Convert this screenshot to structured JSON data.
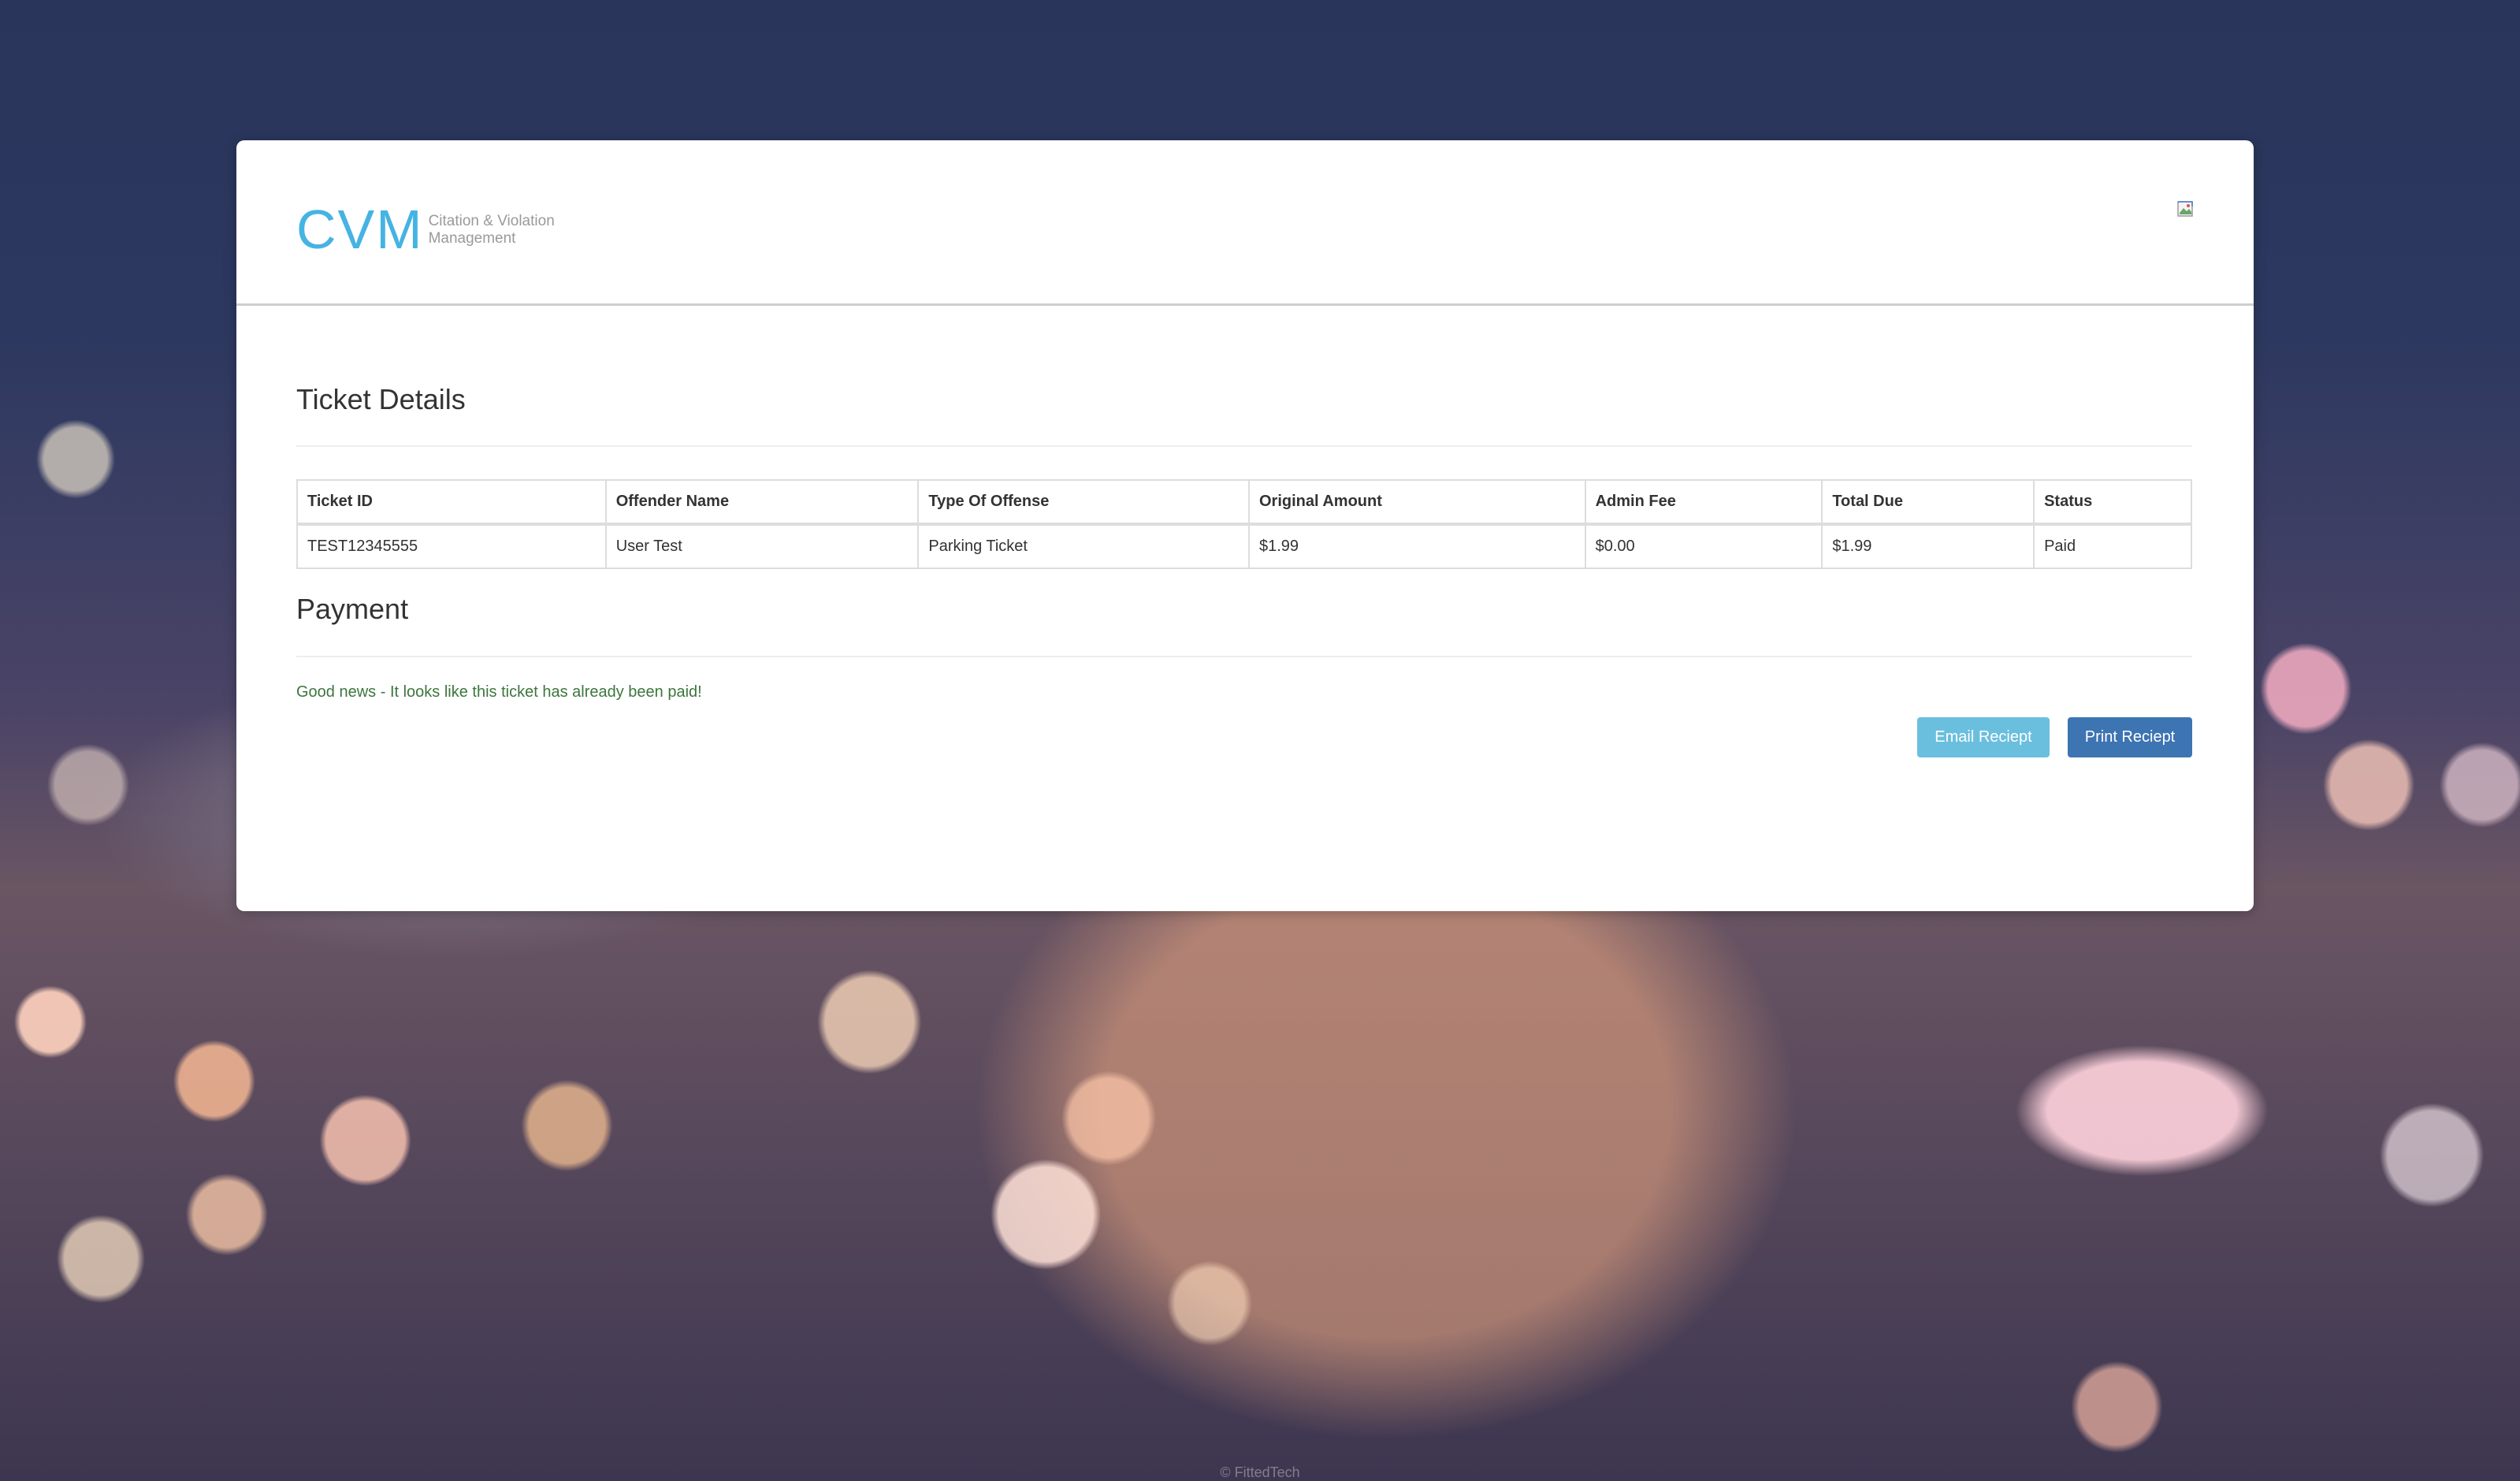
{
  "header": {
    "logo_mark": "CVM",
    "logo_sub_line1": "Citation & Violation",
    "logo_sub_line2": "Management"
  },
  "ticket_details": {
    "title": "Ticket Details",
    "columns": [
      "Ticket ID",
      "Offender Name",
      "Type Of Offense",
      "Original Amount",
      "Admin Fee",
      "Total Due",
      "Status"
    ],
    "rows": [
      [
        "TEST12345555",
        "User Test",
        "Parking Ticket",
        "$1.99",
        "$0.00",
        "$1.99",
        "Paid"
      ]
    ]
  },
  "payment": {
    "title": "Payment",
    "message": "Good news - It looks like this ticket has already been paid!",
    "email_button": "Email Reciept",
    "print_button": "Print Reciept"
  },
  "footer": {
    "text": "© FittedTech"
  },
  "colors": {
    "logo_blue": "#45b3e3",
    "success_green": "#3c763d",
    "email_button": "#6bbfde",
    "print_button": "#3d74b2"
  },
  "icons": {
    "header_right": "broken-image-icon"
  }
}
